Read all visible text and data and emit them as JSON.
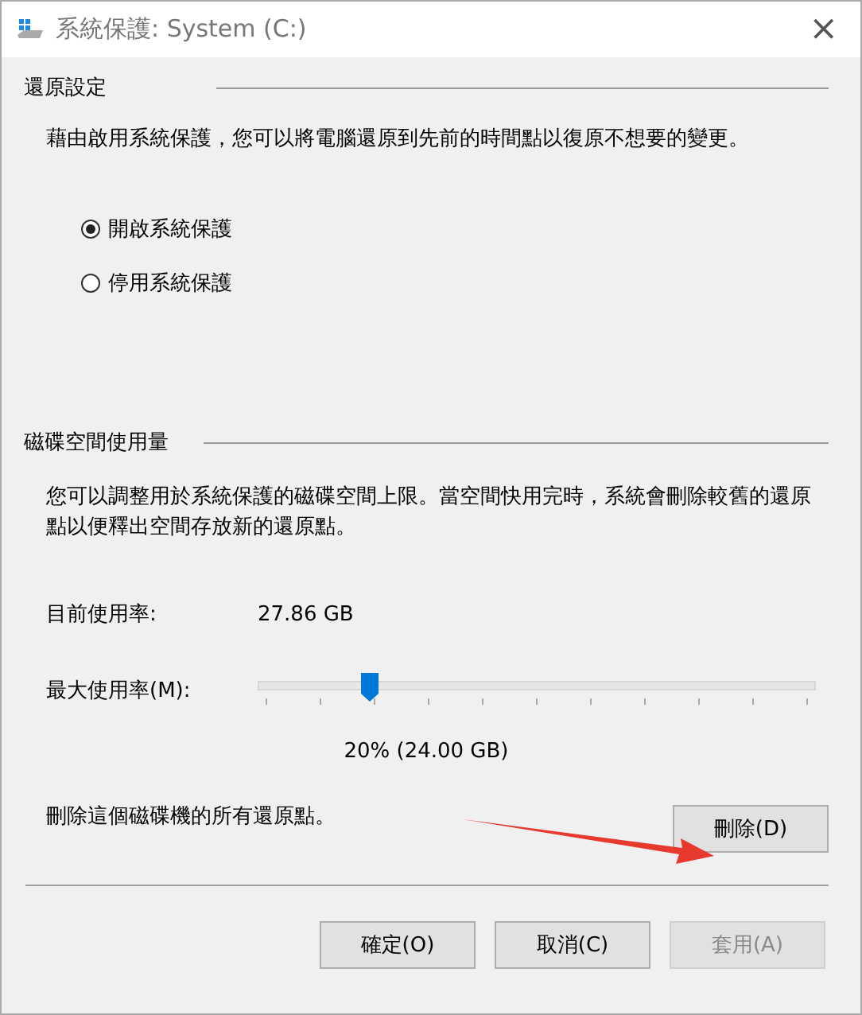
{
  "window": {
    "title": "系統保護: System (C:)",
    "close": "×"
  },
  "restore_settings": {
    "heading": "還原設定",
    "description": "藉由啟用系統保護，您可以將電腦還原到先前的時間點以復原不想要的變更。",
    "options": [
      {
        "label": "開啟系統保護",
        "selected": true
      },
      {
        "label": "停用系統保護",
        "selected": false
      }
    ]
  },
  "disk_usage": {
    "heading": "磁碟空間使用量",
    "description": "您可以調整用於系統保護的磁碟空間上限。當空間快用完時，系統會刪除較舊的還原點以便釋出空間存放新的還原點。",
    "current_label": "目前使用率:",
    "current_value": "27.86 GB",
    "max_label": "最大使用率(M):",
    "slider": {
      "level": 0.2
    },
    "max_reading": "20% (24.00 GB)",
    "delete_text": "刪除這個磁碟機的所有還原點。",
    "delete_button": "刪除(D)"
  },
  "buttons": [
    {
      "label": "確定(O)",
      "disabled": false
    },
    {
      "label": "取消(C)",
      "disabled": false
    },
    {
      "label": "套用(A)",
      "disabled": true
    }
  ]
}
